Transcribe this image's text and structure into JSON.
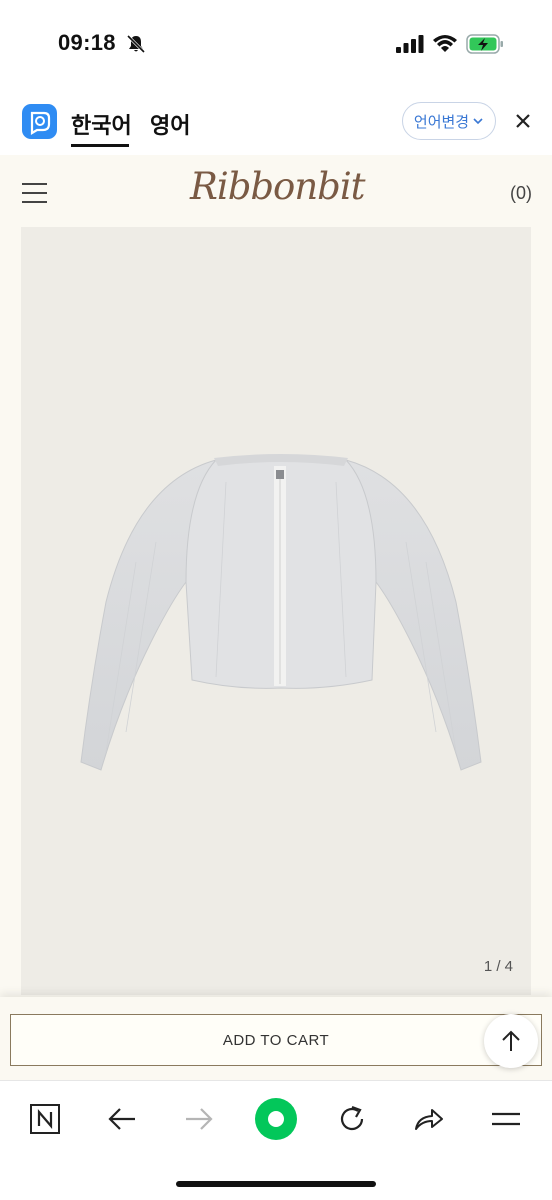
{
  "status_bar": {
    "time": "09:18"
  },
  "translate_bar": {
    "tabs": [
      {
        "label": "한국어",
        "active": true
      },
      {
        "label": "영어",
        "active": false
      }
    ],
    "change_language_label": "언어변경",
    "accent_color": "#3a78d4"
  },
  "site": {
    "brand": "Ribbonbit",
    "cart_count": "(0)",
    "background_color": "#fbf9f2"
  },
  "product": {
    "image_description_icon": "white-cardigan-image",
    "page_indicator": "1 / 4"
  },
  "cart": {
    "add_to_cart_label": "ADD TO CART"
  },
  "toolbar": {
    "items": [
      "naver-n-icon",
      "back-arrow-icon",
      "forward-arrow-icon",
      "green-home-icon",
      "refresh-icon",
      "share-icon",
      "menu-icon"
    ],
    "home_button_color": "#03c75a"
  }
}
